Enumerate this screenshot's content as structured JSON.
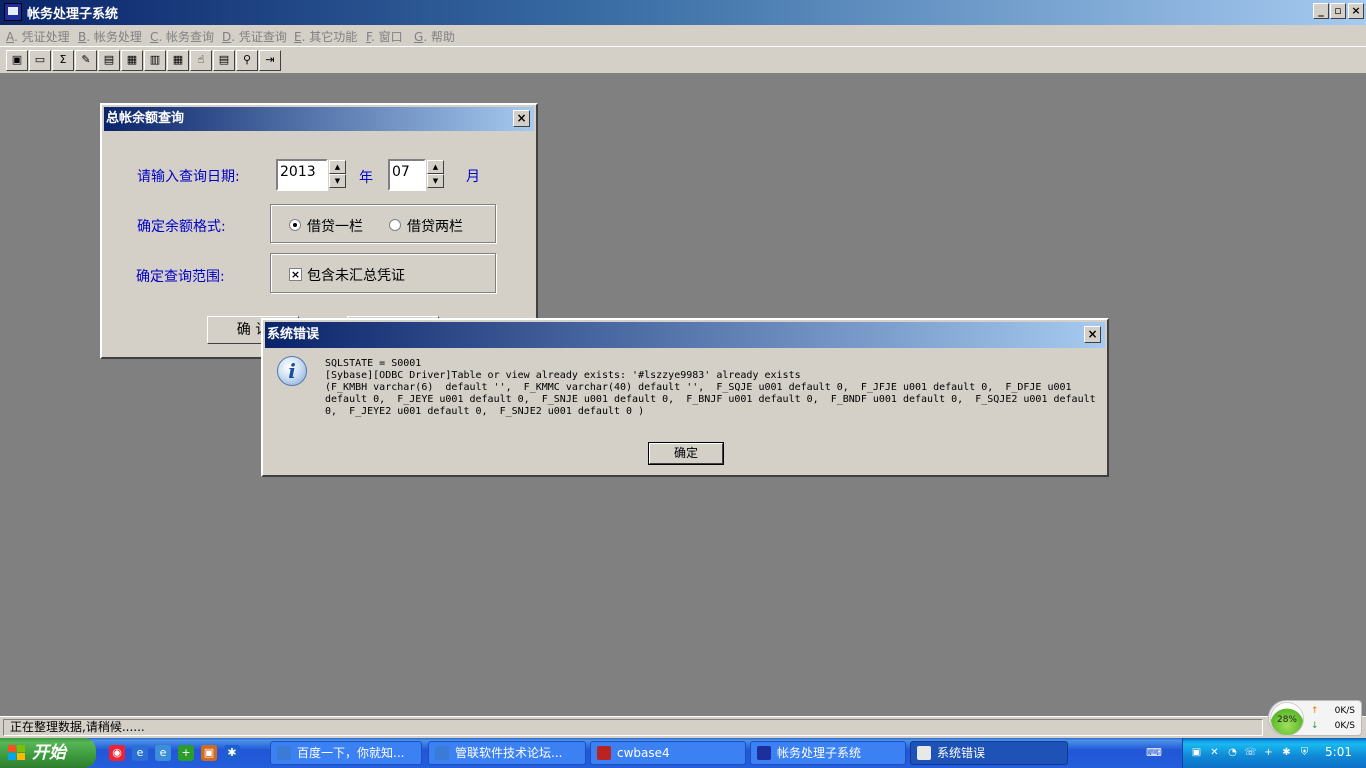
{
  "window": {
    "title": "帐务处理子系统"
  },
  "menu": [
    {
      "key": "A",
      "label": ". 凭证处理"
    },
    {
      "key": "B",
      "label": ". 帐务处理"
    },
    {
      "key": "C",
      "label": ". 帐务查询"
    },
    {
      "key": "D",
      "label": ". 凭证查询"
    },
    {
      "key": "E",
      "label": ". 其它功能"
    },
    {
      "key": "F",
      "label": ". 窗口"
    },
    {
      "key": "G",
      "label": ". 帮助"
    }
  ],
  "toolbar": {
    "sigma_glyph": "Σ"
  },
  "query_dialog": {
    "title": "总帐余额查询",
    "close": "×",
    "date_label": "请输入查询日期:",
    "year_value": "2013",
    "year_unit": "年",
    "month_value": "07",
    "month_unit": "月",
    "spin_up": "▲",
    "spin_down": "▼",
    "format_label": "确定余额格式:",
    "format_option_1": "借贷一栏",
    "format_option_2": "借贷两栏",
    "scope_label": "确定查询范围:",
    "scope_checkbox": "包含未汇总凭证",
    "scope_checkbox_mark": "×",
    "ok_button": "确 认"
  },
  "error_dialog": {
    "title": "系统错误",
    "close": "×",
    "icon_glyph": "i",
    "message": "SQLSTATE = S0001\n[Sybase][ODBC Driver]Table or view already exists: '#lszzye9983' already exists\n(F_KMBH varchar(6)  default '',  F_KMMC varchar(40) default '',  F_SQJE u001 default 0,  F_JFJE u001 default 0,  F_DFJE u001\ndefault 0,  F_JEYE u001 default 0,  F_SNJE u001 default 0,  F_BNJF u001 default 0,  F_BNDF u001 default 0,  F_SQJE2 u001 default\n0,  F_JEYE2 u001 default 0,  F_SNJE2 u001 default 0 )",
    "ok_button": "确定"
  },
  "statusbar": {
    "text": "正在整理数据,请稍候......"
  },
  "net_widget": {
    "percent": "28%",
    "up_arrow": "↑",
    "down_arrow": "↓",
    "up_rate": "0K/S",
    "down_rate": "0K/S"
  },
  "taskbar": {
    "start_label": "开始",
    "tasks": [
      {
        "label": "百度一下，你就知..."
      },
      {
        "label": "管联软件技术论坛..."
      },
      {
        "label": "cwbase4"
      },
      {
        "label": "帐务处理子系统"
      },
      {
        "label": "系统错误"
      }
    ],
    "clock": "5:01"
  },
  "colors": {
    "desktop": "#808080",
    "dialog_face": "#d4d0c8",
    "label_blue": "#0000c8",
    "title_dark": "#0a246a",
    "taskbar_blue": "#245edb",
    "start_green": "#3c9a3c"
  }
}
